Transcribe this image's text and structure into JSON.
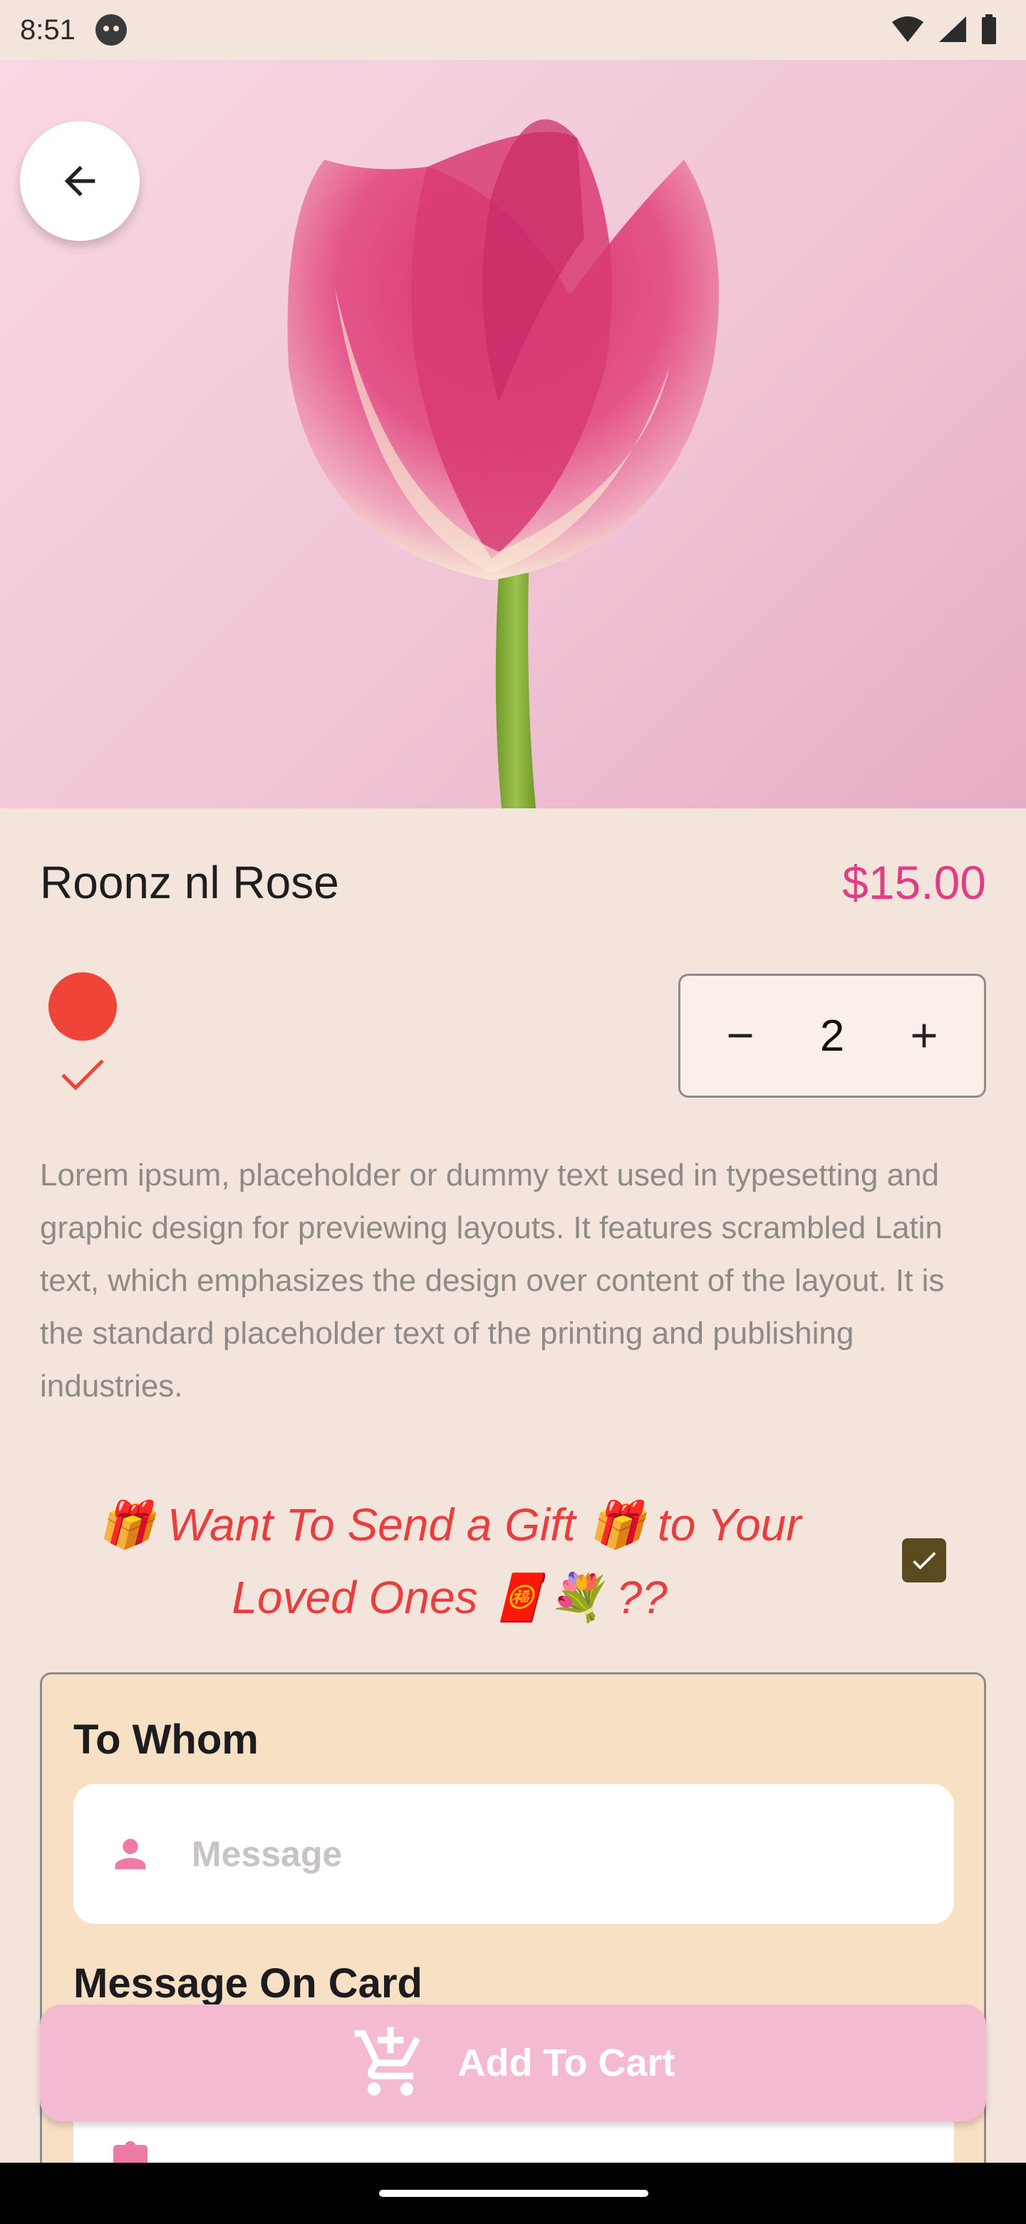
{
  "status_bar": {
    "time": "8:51"
  },
  "product": {
    "name": "Roonz nl Rose",
    "price": "$15.00",
    "color": "#f04438",
    "quantity": "2",
    "description": "Lorem ipsum, placeholder or dummy text used in typesetting and graphic design for previewing layouts. It features scrambled Latin text, which emphasizes the design over content of the layout. It is the standard placeholder text of the printing and publishing industries."
  },
  "gift": {
    "prompt": "🎁 Want To Send a Gift 🎁 to Your Loved Ones 🧧💐 ??",
    "checked": true,
    "to_whom_label": "To Whom",
    "recipient_placeholder": "Message",
    "message_label": "Message On Card"
  },
  "actions": {
    "add_to_cart_label": "Add To Cart"
  },
  "colors": {
    "accent": "#e03d86",
    "background": "#f3e4dc",
    "cart_button": "#f4bad1",
    "gift_card": "#f8e0c4",
    "checkbox": "#5c4a1f"
  },
  "icons": [
    "back-arrow-icon",
    "checkmark-icon",
    "minus-icon",
    "plus-icon",
    "check-icon",
    "person-icon",
    "edit-icon",
    "add-cart-icon",
    "wifi-icon",
    "signal-icon",
    "battery-icon"
  ]
}
